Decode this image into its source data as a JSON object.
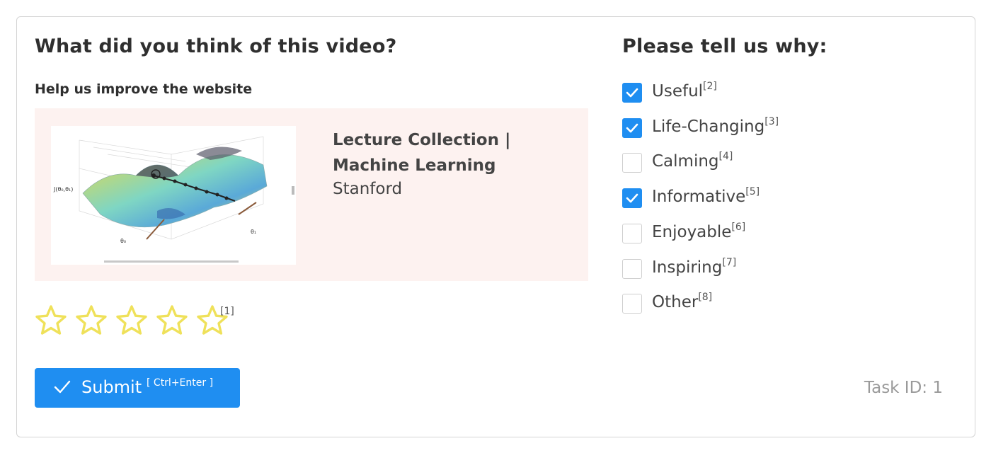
{
  "rating": {
    "title": "What did you think of this video?",
    "subtitle": "Help us improve the website",
    "video": {
      "title": "Lecture Collection | Machine Learning",
      "source": "Stanford",
      "thumbnail_icon": "3d-surface-plot-thumbnail"
    },
    "stars": {
      "count": 5,
      "selected": 0,
      "hotkey": "[1]",
      "color": "#efe15a"
    }
  },
  "reasons": {
    "title": "Please tell us why:",
    "options": [
      {
        "label": "Useful",
        "hotkey": "[2]",
        "checked": true
      },
      {
        "label": "Life-Changing",
        "hotkey": "[3]",
        "checked": true
      },
      {
        "label": "Calming",
        "hotkey": "[4]",
        "checked": false
      },
      {
        "label": "Informative",
        "hotkey": "[5]",
        "checked": true
      },
      {
        "label": "Enjoyable",
        "hotkey": "[6]",
        "checked": false
      },
      {
        "label": "Inspiring",
        "hotkey": "[7]",
        "checked": false
      },
      {
        "label": "Other",
        "hotkey": "[8]",
        "checked": false
      }
    ]
  },
  "submit": {
    "label": "Submit",
    "hotkey": "[ Ctrl+Enter ]",
    "icon": "check-icon",
    "color": "#1f8ef1"
  },
  "task": {
    "label": "Task ID: 1"
  }
}
